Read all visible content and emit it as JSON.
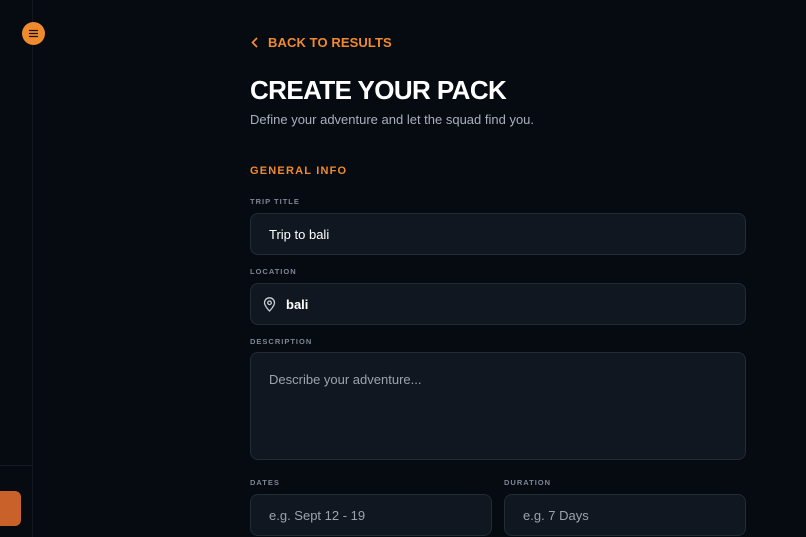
{
  "nav": {
    "menu_icon": "hamburger-icon",
    "back_label": "BACK TO RESULTS",
    "back_icon": "chevron-left-icon"
  },
  "header": {
    "title": "CREATE YOUR PACK",
    "subtitle": "Define your adventure and let the squad find you."
  },
  "form": {
    "section_title": "GENERAL INFO",
    "trip_title": {
      "label": "TRIP TITLE",
      "value": "Trip to bali"
    },
    "location": {
      "label": "LOCATION",
      "value": "bali",
      "icon": "map-pin-icon"
    },
    "description": {
      "label": "DESCRIPTION",
      "placeholder": "Describe your adventure..."
    },
    "dates": {
      "label": "DATES",
      "placeholder": "e.g. Sept 12 - 19"
    },
    "duration": {
      "label": "DURATION",
      "placeholder": "e.g. 7 Days"
    }
  },
  "colors": {
    "accent": "#f08a2e",
    "background": "#060a11",
    "field_bg": "#111720"
  }
}
